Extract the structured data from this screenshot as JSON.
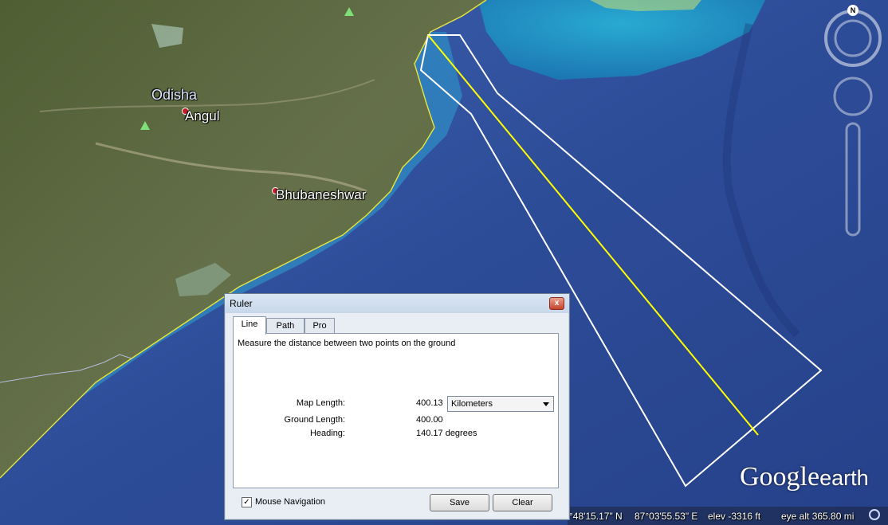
{
  "map": {
    "labels": {
      "region": "Odisha",
      "city1": "Angul",
      "city2": "Bhubaneshwar"
    },
    "colors": {
      "land": "#5b6a3c",
      "ocean": "#2e4f9a",
      "shallow": "#1f8fc0",
      "measure_line": "#ffff00",
      "coastline": "#e6e63a"
    }
  },
  "ruler": {
    "title": "Ruler",
    "close_glyph": "x",
    "tabs": [
      "Line",
      "Path",
      "Pro"
    ],
    "active_tab": "Line",
    "description": "Measure the distance between two points on the ground",
    "map_length_label": "Map Length:",
    "map_length_value": "400.13",
    "unit_selected": "Kilometers",
    "ground_length_label": "Ground Length:",
    "ground_length_value": "400.00",
    "heading_label": "Heading:",
    "heading_value": "140.17 degrees",
    "mouse_nav_label": "Mouse Navigation",
    "mouse_nav_checked": true,
    "check_glyph": "✓",
    "save_label": "Save",
    "clear_label": "Clear"
  },
  "status": {
    "lat": "°48'15.17\" N",
    "lon": "87°03'55.53\" E",
    "elev": "elev -3316 ft",
    "eye_alt": "eye alt 365.80 mi"
  },
  "logo": {
    "google": "Google",
    "earth": "earth"
  },
  "nav": {
    "north": "N",
    "icons": [
      "compass-ring-icon",
      "look-joystick-icon",
      "zoom-slider-icon"
    ]
  }
}
